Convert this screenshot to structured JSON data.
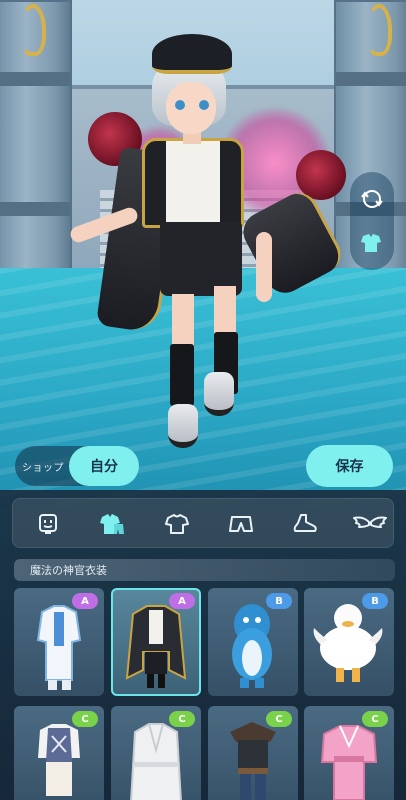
{
  "controls": {
    "shop_tab_label": "ショップ",
    "self_tab_label": "自分",
    "save_label": "保存"
  },
  "side_tools": [
    {
      "icon": "rotate-view-icon"
    },
    {
      "icon": "outfit-icon"
    }
  ],
  "categories": [
    {
      "icon": "face-icon",
      "active": false
    },
    {
      "icon": "outfit-set-icon",
      "active": true
    },
    {
      "icon": "shirt-icon",
      "active": false
    },
    {
      "icon": "pants-icon",
      "active": false
    },
    {
      "icon": "shoe-icon",
      "active": false
    },
    {
      "icon": "wings-icon",
      "active": false
    }
  ],
  "set_name": "魔法の神官衣装",
  "items": [
    {
      "rank": "A",
      "name": "white-blue-suit",
      "selected": false
    },
    {
      "rank": "A",
      "name": "priest-outfit",
      "selected": true
    },
    {
      "rank": "B",
      "name": "blue-whale-costume",
      "selected": false
    },
    {
      "rank": "B",
      "name": "white-duck-costume",
      "selected": false
    },
    {
      "rank": "C",
      "name": "argyle-vest-outfit",
      "selected": false
    },
    {
      "rank": "C",
      "name": "white-bathrobe",
      "selected": false
    },
    {
      "rank": "C",
      "name": "adventurer-outfit",
      "selected": false
    },
    {
      "rank": "C",
      "name": "pink-kimono",
      "selected": false
    }
  ],
  "colors": {
    "accent": "#7ff0ee",
    "rank_A": "#c06ee6",
    "rank_B": "#4d9be8",
    "rank_C": "#7ad14a",
    "selected_outline": "#6be4ea"
  }
}
